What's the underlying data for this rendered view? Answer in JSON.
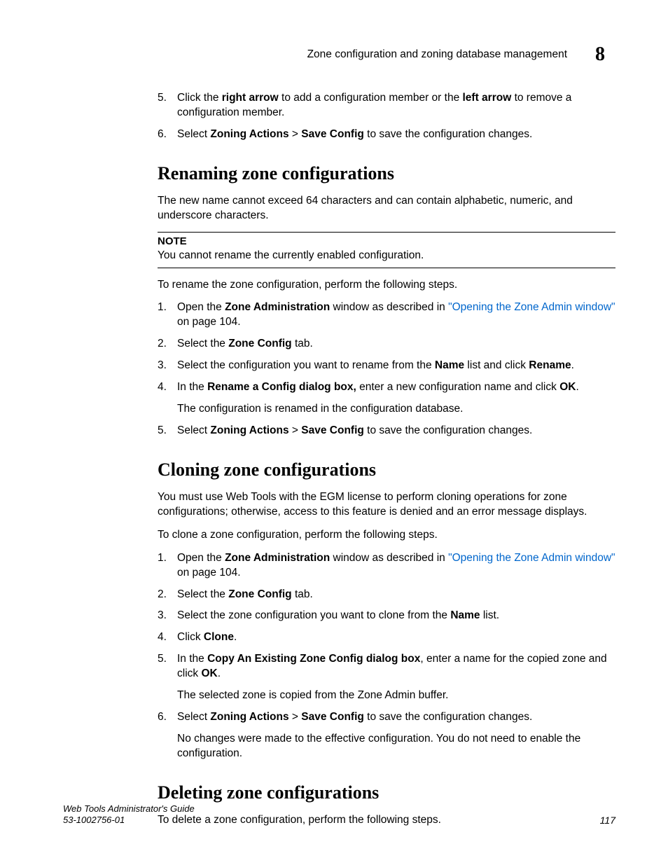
{
  "header": {
    "title": "Zone configuration and zoning database management",
    "chapter": "8"
  },
  "intro_steps": [
    {
      "num": "5.",
      "pre": "Click the ",
      "b1": "right arrow",
      "mid": " to add a configuration member or the ",
      "b2": "left arrow",
      "post": " to remove a configuration member."
    },
    {
      "num": "6.",
      "pre": "Select ",
      "b1": "Zoning Actions",
      "mid": " > ",
      "b2": "Save Config",
      "post": " to save the configuration changes."
    }
  ],
  "renaming": {
    "heading": "Renaming zone configurations",
    "intro": "The new name cannot exceed 64 characters and can contain alphabetic, numeric, and underscore characters.",
    "note_title": "NOTE",
    "note_body": "You cannot rename the currently enabled configuration.",
    "lead": "To rename the zone configuration, perform the following steps.",
    "steps": [
      {
        "num": "1.",
        "pre": "Open the ",
        "b1": "Zone Administration",
        "mid": " window as described in ",
        "link": "\"Opening the Zone Admin window\"",
        "post": " on page 104."
      },
      {
        "num": "2.",
        "pre": "Select the ",
        "b1": "Zone Config",
        "mid": " tab."
      },
      {
        "num": "3.",
        "pre": "Select the configuration you want to rename from the ",
        "b1": "Name",
        "mid": " list and click ",
        "b2": "Rename",
        "post": "."
      },
      {
        "num": "4.",
        "pre": "In the ",
        "b1": "Rename a Config dialog box,",
        "mid": " enter a new configuration name and click ",
        "b2": "OK",
        "post": ".",
        "follow": "The configuration is renamed in the configuration database."
      },
      {
        "num": "5.",
        "pre": "Select ",
        "b1": "Zoning Actions",
        "mid": " > ",
        "b2": "Save Config",
        "post": " to save the configuration changes."
      }
    ]
  },
  "cloning": {
    "heading": "Cloning zone configurations",
    "intro": "You must use Web Tools with the EGM license to perform cloning operations for zone configurations; otherwise, access to this feature is denied and an error message displays.",
    "lead": "To clone a zone configuration, perform the following steps.",
    "steps": [
      {
        "num": "1.",
        "pre": "Open the ",
        "b1": "Zone Administration",
        "mid": " window as described in ",
        "link": "\"Opening the Zone Admin window\"",
        "post": " on page 104."
      },
      {
        "num": "2.",
        "pre": "Select the ",
        "b1": "Zone Config",
        "mid": " tab."
      },
      {
        "num": "3.",
        "pre": "Select the zone configuration you want to clone from the ",
        "b1": "Name",
        "mid": " list."
      },
      {
        "num": "4.",
        "pre": "Click ",
        "b1": "Clone",
        "mid": "."
      },
      {
        "num": "5.",
        "pre": "In the ",
        "b1": "Copy An Existing Zone Config dialog box",
        "mid": ", enter a name for the copied zone and click ",
        "b2": "OK",
        "post": ".",
        "follow": "The selected zone is copied from the Zone Admin buffer."
      },
      {
        "num": "6.",
        "pre": "Select ",
        "b1": "Zoning Actions",
        "mid": " > ",
        "b2": "Save Config",
        "post": " to save the configuration changes.",
        "follow": "No changes were made to the effective configuration. You do not need to enable the configuration."
      }
    ]
  },
  "deleting": {
    "heading": "Deleting zone configurations",
    "lead": "To delete a zone configuration, perform the following steps."
  },
  "footer": {
    "title": "Web Tools Administrator's Guide",
    "docnum": "53-1002756-01",
    "page": "117"
  }
}
